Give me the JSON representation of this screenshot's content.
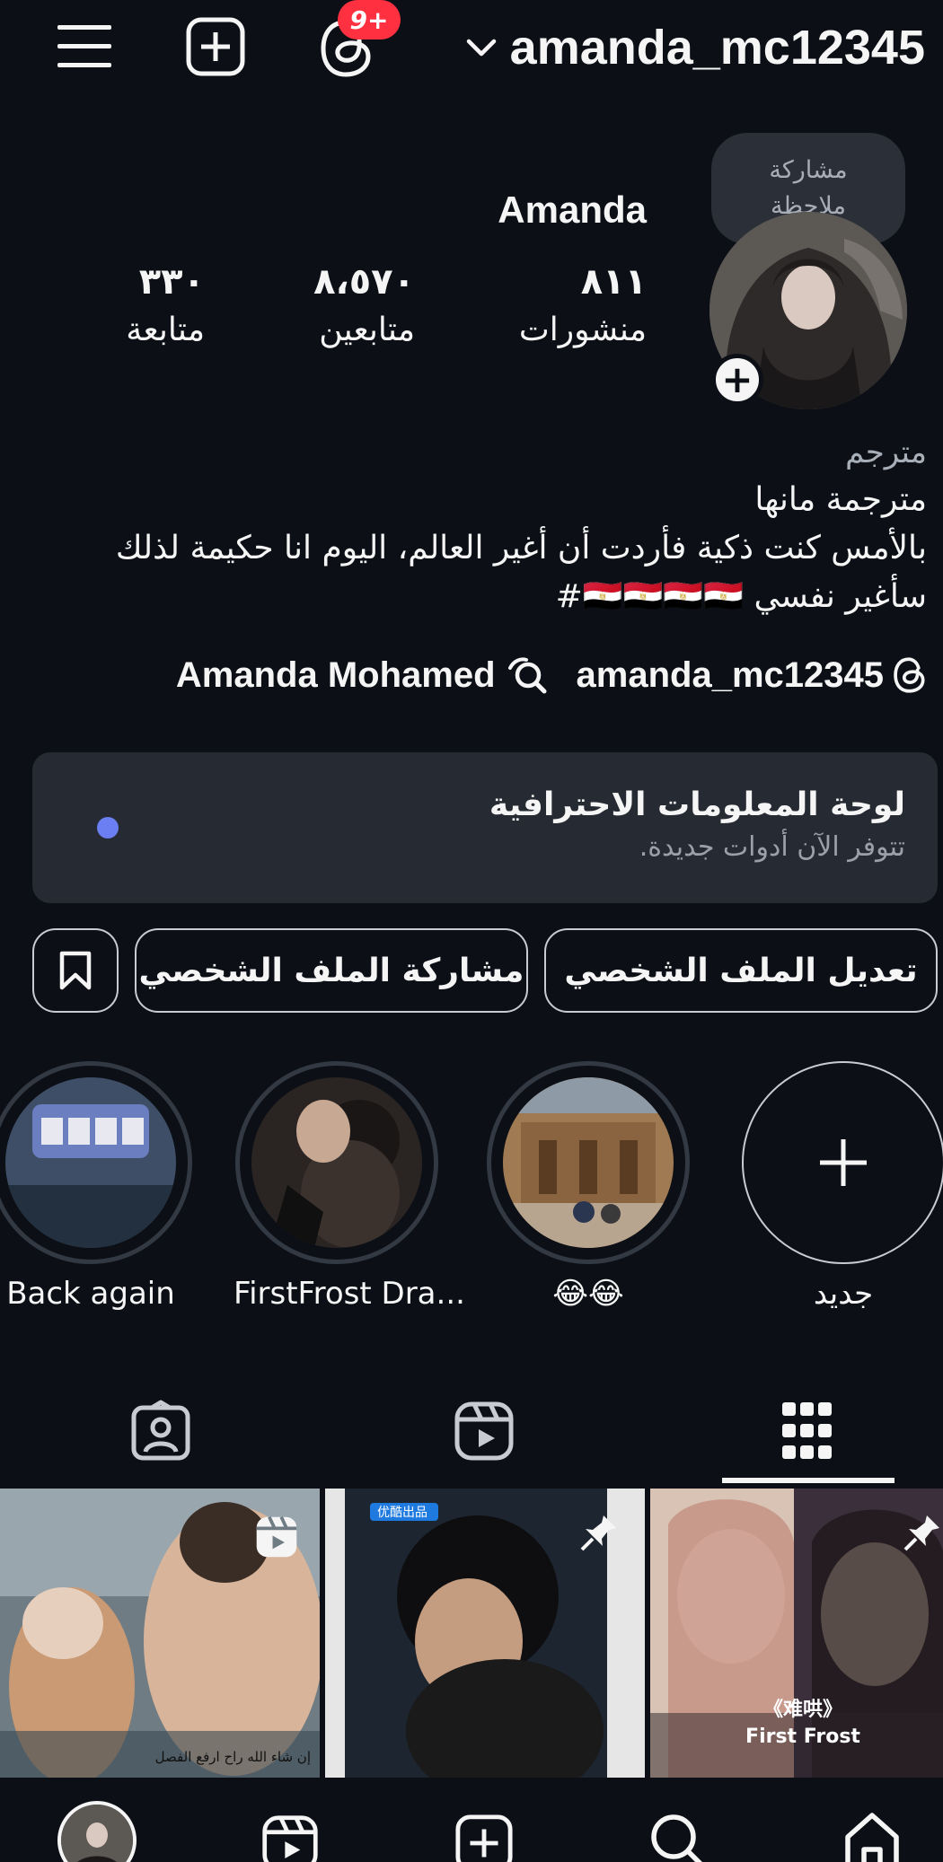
{
  "header": {
    "username": "amanda_mc12345",
    "notification_badge": "9+"
  },
  "note": {
    "line1": "مشاركة",
    "line2": "ملاحظة"
  },
  "profile": {
    "display_name": "Amanda",
    "stats": [
      {
        "value": "٨١١",
        "label": "منشورات"
      },
      {
        "value": "٨،٥٧٠",
        "label": "متابعين"
      },
      {
        "value": "٣٣٠",
        "label": "متابعة"
      }
    ],
    "category": "مترجم",
    "bio_lines": [
      "مترجمة مانها",
      "بالأمس كنت ذكية فأردت أن أغير العالم، اليوم انا حكيمة لذلك",
      "سأغير نفسي 🇪🇬🇪🇬🇪🇬🇪🇬#"
    ],
    "threads_handle": "amanda_mc12345",
    "linked_name": "Amanda Mohamed"
  },
  "dashboard": {
    "title": "لوحة المعلومات الاحترافية",
    "subtitle": "تتوفر الآن أدوات جديدة."
  },
  "buttons": {
    "edit_profile": "تعديل الملف الشخصي",
    "share_profile": "مشاركة الملف الشخصي"
  },
  "highlights": [
    {
      "label": "جديد"
    },
    {
      "label": "😂😂"
    },
    {
      "label": "FirstFrost Dra..."
    },
    {
      "label": "Back again"
    }
  ],
  "colors": {
    "background": "#0c1016",
    "badge": "#ff3040",
    "dashboard_dot": "#6b7ef2",
    "card": "#262a33"
  },
  "grid": {
    "cells": [
      {
        "caption": "إن شاء الله راح ارفع الفصل"
      },
      {
        "caption": "优酷出品"
      },
      {
        "caption": "《难哄》 First Frost"
      }
    ]
  }
}
